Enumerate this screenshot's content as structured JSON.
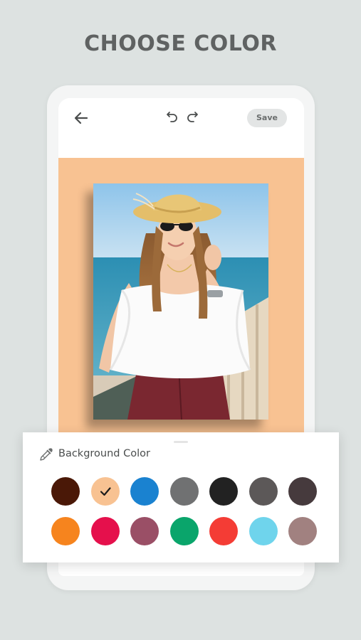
{
  "headline": "CHOOSE COLOR",
  "toolbar": {
    "save_label": "Save"
  },
  "panel": {
    "title": "Background Color"
  },
  "canvas": {
    "background_color": "#f8c292"
  },
  "colors": {
    "row1": [
      "#4a1807",
      "#f8c292",
      "#1a82d0",
      "#707172",
      "#222222",
      "#5c5858",
      "#463a3d"
    ],
    "row2": [
      "#f6841e",
      "#e5104c",
      "#9a4f66",
      "#0aa56b",
      "#f43c35",
      "#6fd4ec",
      "#a18180"
    ],
    "selected": "#f8c292"
  },
  "icons": {
    "back": "arrow-left-icon",
    "undo": "undo-icon",
    "redo": "redo-icon",
    "panel": "eyedropper-icon",
    "check": "checkmark-icon"
  }
}
